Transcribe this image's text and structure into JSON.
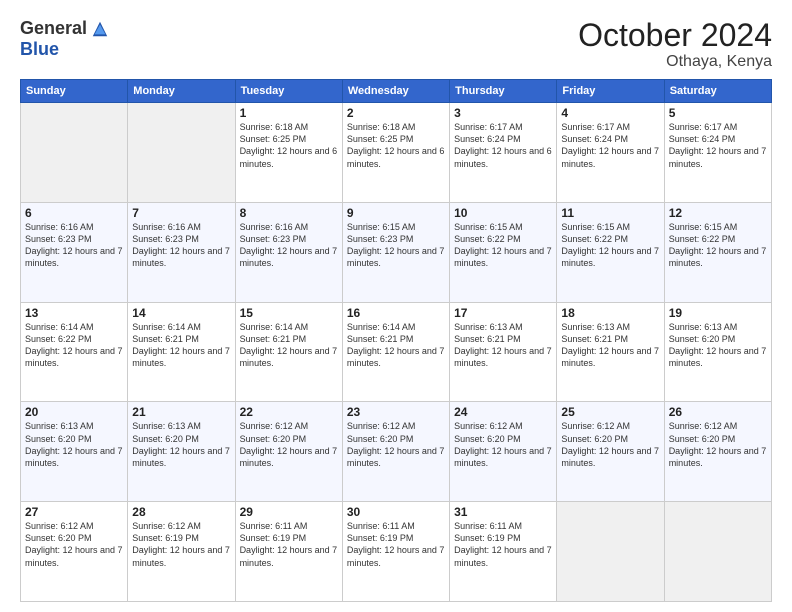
{
  "logo": {
    "general": "General",
    "blue": "Blue"
  },
  "title": "October 2024",
  "location": "Othaya, Kenya",
  "days_of_week": [
    "Sunday",
    "Monday",
    "Tuesday",
    "Wednesday",
    "Thursday",
    "Friday",
    "Saturday"
  ],
  "weeks": [
    [
      {
        "day": "",
        "info": ""
      },
      {
        "day": "",
        "info": ""
      },
      {
        "day": "1",
        "info": "Sunrise: 6:18 AM\nSunset: 6:25 PM\nDaylight: 12 hours and 6 minutes."
      },
      {
        "day": "2",
        "info": "Sunrise: 6:18 AM\nSunset: 6:25 PM\nDaylight: 12 hours and 6 minutes."
      },
      {
        "day": "3",
        "info": "Sunrise: 6:17 AM\nSunset: 6:24 PM\nDaylight: 12 hours and 6 minutes."
      },
      {
        "day": "4",
        "info": "Sunrise: 6:17 AM\nSunset: 6:24 PM\nDaylight: 12 hours and 7 minutes."
      },
      {
        "day": "5",
        "info": "Sunrise: 6:17 AM\nSunset: 6:24 PM\nDaylight: 12 hours and 7 minutes."
      }
    ],
    [
      {
        "day": "6",
        "info": "Sunrise: 6:16 AM\nSunset: 6:23 PM\nDaylight: 12 hours and 7 minutes."
      },
      {
        "day": "7",
        "info": "Sunrise: 6:16 AM\nSunset: 6:23 PM\nDaylight: 12 hours and 7 minutes."
      },
      {
        "day": "8",
        "info": "Sunrise: 6:16 AM\nSunset: 6:23 PM\nDaylight: 12 hours and 7 minutes."
      },
      {
        "day": "9",
        "info": "Sunrise: 6:15 AM\nSunset: 6:23 PM\nDaylight: 12 hours and 7 minutes."
      },
      {
        "day": "10",
        "info": "Sunrise: 6:15 AM\nSunset: 6:22 PM\nDaylight: 12 hours and 7 minutes."
      },
      {
        "day": "11",
        "info": "Sunrise: 6:15 AM\nSunset: 6:22 PM\nDaylight: 12 hours and 7 minutes."
      },
      {
        "day": "12",
        "info": "Sunrise: 6:15 AM\nSunset: 6:22 PM\nDaylight: 12 hours and 7 minutes."
      }
    ],
    [
      {
        "day": "13",
        "info": "Sunrise: 6:14 AM\nSunset: 6:22 PM\nDaylight: 12 hours and 7 minutes."
      },
      {
        "day": "14",
        "info": "Sunrise: 6:14 AM\nSunset: 6:21 PM\nDaylight: 12 hours and 7 minutes."
      },
      {
        "day": "15",
        "info": "Sunrise: 6:14 AM\nSunset: 6:21 PM\nDaylight: 12 hours and 7 minutes."
      },
      {
        "day": "16",
        "info": "Sunrise: 6:14 AM\nSunset: 6:21 PM\nDaylight: 12 hours and 7 minutes."
      },
      {
        "day": "17",
        "info": "Sunrise: 6:13 AM\nSunset: 6:21 PM\nDaylight: 12 hours and 7 minutes."
      },
      {
        "day": "18",
        "info": "Sunrise: 6:13 AM\nSunset: 6:21 PM\nDaylight: 12 hours and 7 minutes."
      },
      {
        "day": "19",
        "info": "Sunrise: 6:13 AM\nSunset: 6:20 PM\nDaylight: 12 hours and 7 minutes."
      }
    ],
    [
      {
        "day": "20",
        "info": "Sunrise: 6:13 AM\nSunset: 6:20 PM\nDaylight: 12 hours and 7 minutes."
      },
      {
        "day": "21",
        "info": "Sunrise: 6:13 AM\nSunset: 6:20 PM\nDaylight: 12 hours and 7 minutes."
      },
      {
        "day": "22",
        "info": "Sunrise: 6:12 AM\nSunset: 6:20 PM\nDaylight: 12 hours and 7 minutes."
      },
      {
        "day": "23",
        "info": "Sunrise: 6:12 AM\nSunset: 6:20 PM\nDaylight: 12 hours and 7 minutes."
      },
      {
        "day": "24",
        "info": "Sunrise: 6:12 AM\nSunset: 6:20 PM\nDaylight: 12 hours and 7 minutes."
      },
      {
        "day": "25",
        "info": "Sunrise: 6:12 AM\nSunset: 6:20 PM\nDaylight: 12 hours and 7 minutes."
      },
      {
        "day": "26",
        "info": "Sunrise: 6:12 AM\nSunset: 6:20 PM\nDaylight: 12 hours and 7 minutes."
      }
    ],
    [
      {
        "day": "27",
        "info": "Sunrise: 6:12 AM\nSunset: 6:20 PM\nDaylight: 12 hours and 7 minutes."
      },
      {
        "day": "28",
        "info": "Sunrise: 6:12 AM\nSunset: 6:19 PM\nDaylight: 12 hours and 7 minutes."
      },
      {
        "day": "29",
        "info": "Sunrise: 6:11 AM\nSunset: 6:19 PM\nDaylight: 12 hours and 7 minutes."
      },
      {
        "day": "30",
        "info": "Sunrise: 6:11 AM\nSunset: 6:19 PM\nDaylight: 12 hours and 7 minutes."
      },
      {
        "day": "31",
        "info": "Sunrise: 6:11 AM\nSunset: 6:19 PM\nDaylight: 12 hours and 7 minutes."
      },
      {
        "day": "",
        "info": ""
      },
      {
        "day": "",
        "info": ""
      }
    ]
  ]
}
